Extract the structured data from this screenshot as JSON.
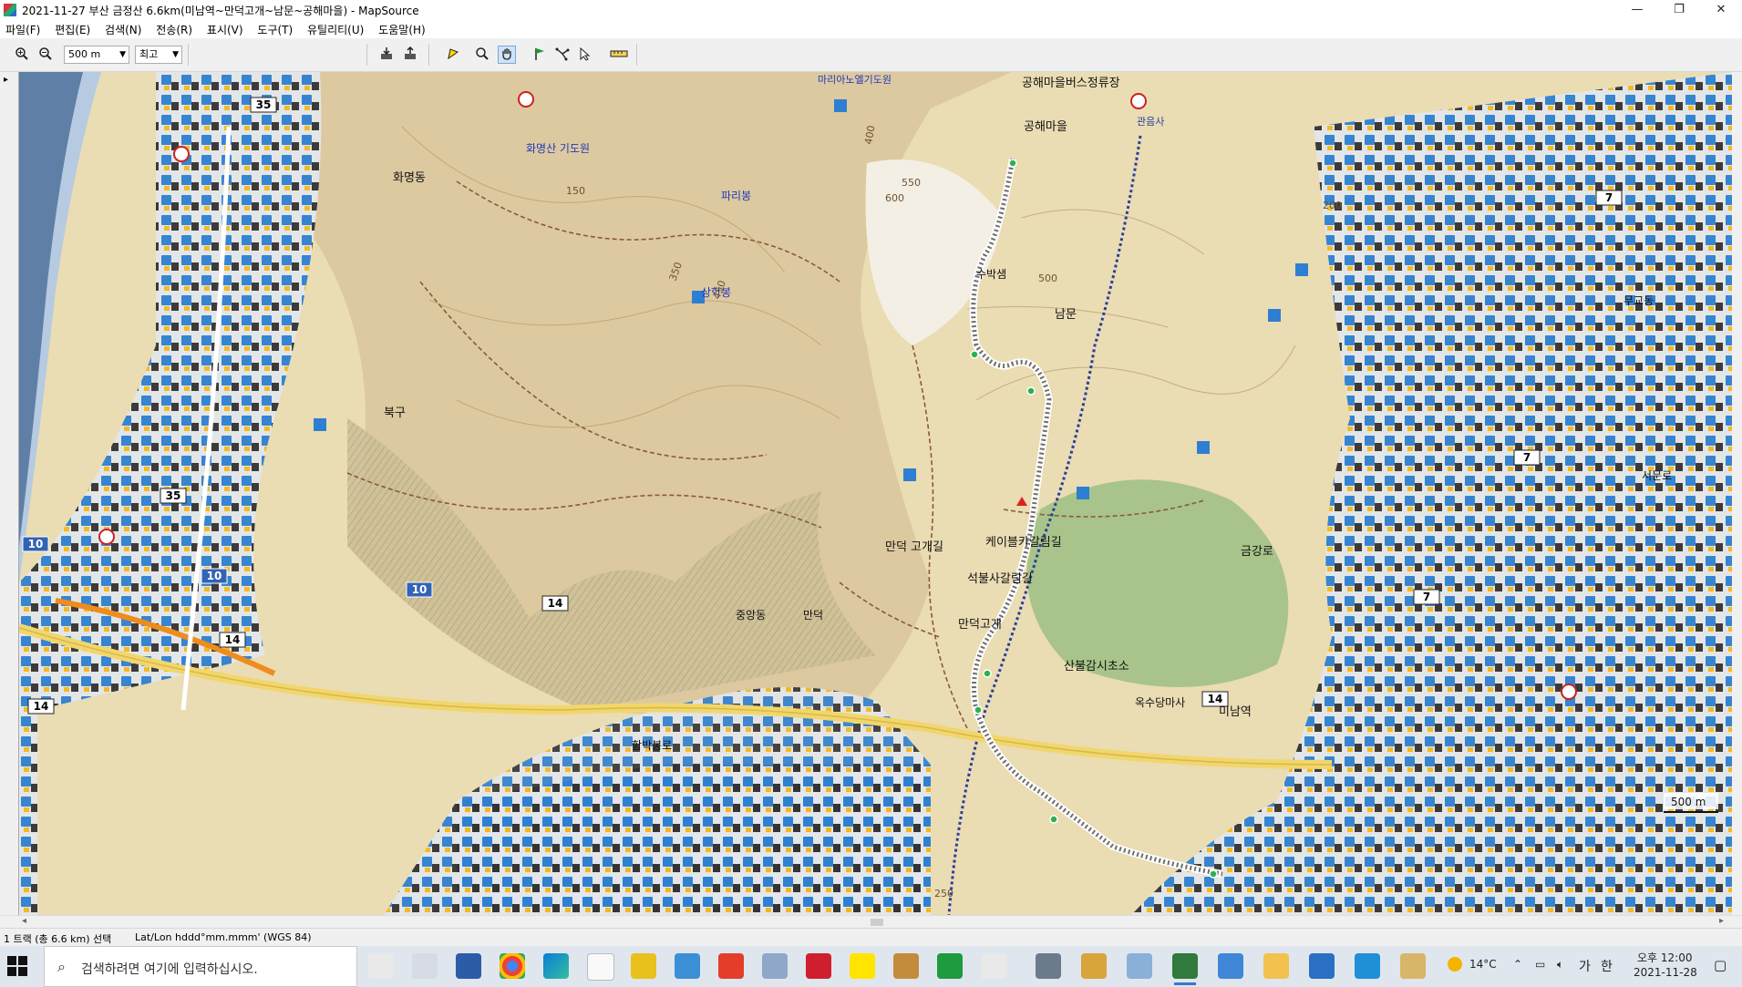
{
  "window": {
    "title": "2021-11-27 부산 금정산 6.6km(미남역~만덕고개~남문~공해마을) - MapSource",
    "minimize": "—",
    "restore": "❐",
    "close": "✕"
  },
  "menu": [
    "파일(F)",
    "편집(E)",
    "검색(N)",
    "전송(R)",
    "표시(V)",
    "도구(T)",
    "유틸리티(U)",
    "도움말(H)"
  ],
  "toolbar": {
    "zoom_value": "500 m",
    "detail_value": "최고",
    "icons": [
      "zoom-in-icon",
      "zoom-out-icon",
      "receive-from-device-icon",
      "send-to-device-icon",
      "select-icon",
      "zoom-tool-icon",
      "hand-tool-icon",
      "waypoint-tool-icon",
      "route-tool-icon",
      "pointer-tool-icon",
      "measure-tool-icon"
    ]
  },
  "map": {
    "place_labels": [
      "공해마을버스정류장",
      "공해마을",
      "관음사",
      "화명동",
      "화명산 기도원",
      "파리봉",
      "상학봉",
      "남문",
      "수박샘",
      "북구",
      "만덕 고개길",
      "케이블카갈림길",
      "석불사갈림길",
      "만덕고개",
      "산불감시초소",
      "미남역",
      "금강로",
      "중앙동",
      "만덕",
      "함박봉로",
      "옥수당마사",
      "무교동",
      "서문로",
      "마리아노엘기도원"
    ],
    "road_numbers": [
      "35",
      "10",
      "14",
      "7"
    ],
    "contours": [
      "400",
      "550",
      "600",
      "500",
      "350",
      "450",
      "250",
      "200",
      "150"
    ],
    "scale_bar": "500 m"
  },
  "status": {
    "selection": "1 트랙 (총 6.6 km) 선택",
    "coords": "Lat/Lon hddd°mm.mmm' (WGS 84)"
  },
  "taskbar": {
    "search_placeholder": "검색하려면 여기에 입력하십시오.",
    "weather": "14°C",
    "ime": "가",
    "ime2": "한",
    "time": "오후 12:00",
    "date": "2021-11-28"
  }
}
